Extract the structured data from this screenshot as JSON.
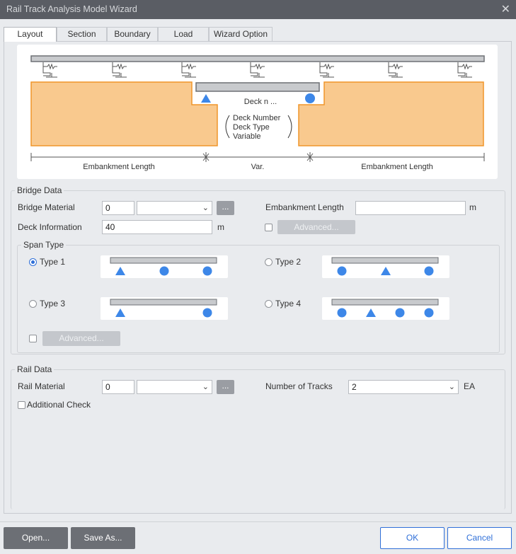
{
  "window": {
    "title": "Rail Track Analysis Model Wizard",
    "close_glyph": "✕"
  },
  "tabs": [
    {
      "label": "Layout",
      "active": true
    },
    {
      "label": "Section"
    },
    {
      "label": "Boundary"
    },
    {
      "label": "Load"
    },
    {
      "label": "Wizard Option"
    }
  ],
  "diagram": {
    "deck_label": "Deck n ...",
    "var_lines": [
      "Deck Number",
      "Deck Type",
      "Variable"
    ],
    "dim_labels": [
      "Embankment Length",
      "Var.",
      "Embankment Length"
    ],
    "colors": {
      "embankment_fill": "#f9c98e",
      "embankment_stroke": "#f0962a",
      "rail": "#c8cacd",
      "support": "#3d87e8"
    }
  },
  "bridge_data": {
    "legend": "Bridge Data",
    "material_label": "Bridge Material",
    "material_value": "0",
    "material_select": "",
    "material_btn": "...",
    "embankment_label": "Embankment Length",
    "embankment_value": "",
    "embankment_unit": "m",
    "deck_info_label": "Deck Information",
    "deck_info_value": "40",
    "deck_info_unit": "m",
    "advanced_label": "Advanced...",
    "advanced_checked": false
  },
  "span_type": {
    "legend": "Span Type",
    "types": [
      {
        "label": "Type 1",
        "selected": true,
        "supports": [
          "triangle",
          "circle",
          "circle"
        ]
      },
      {
        "label": "Type 2",
        "selected": false,
        "supports": [
          "circle",
          "triangle",
          "circle"
        ]
      },
      {
        "label": "Type 3",
        "selected": false,
        "supports": [
          "triangle",
          "circle"
        ]
      },
      {
        "label": "Type 4",
        "selected": false,
        "supports": [
          "circle",
          "triangle",
          "circle",
          "circle"
        ]
      }
    ],
    "advanced_label": "Advanced...",
    "advanced_checked": false
  },
  "rail_data": {
    "legend": "Rail Data",
    "material_label": "Rail Material",
    "material_value": "0",
    "material_select": "",
    "material_btn": "...",
    "tracks_label": "Number of Tracks",
    "tracks_value": "2",
    "tracks_unit": "EA",
    "additional_check_label": "Additional Check",
    "additional_checked": false
  },
  "footer": {
    "open_label": "Open...",
    "save_as_label": "Save As...",
    "ok_label": "OK",
    "cancel_label": "Cancel"
  }
}
